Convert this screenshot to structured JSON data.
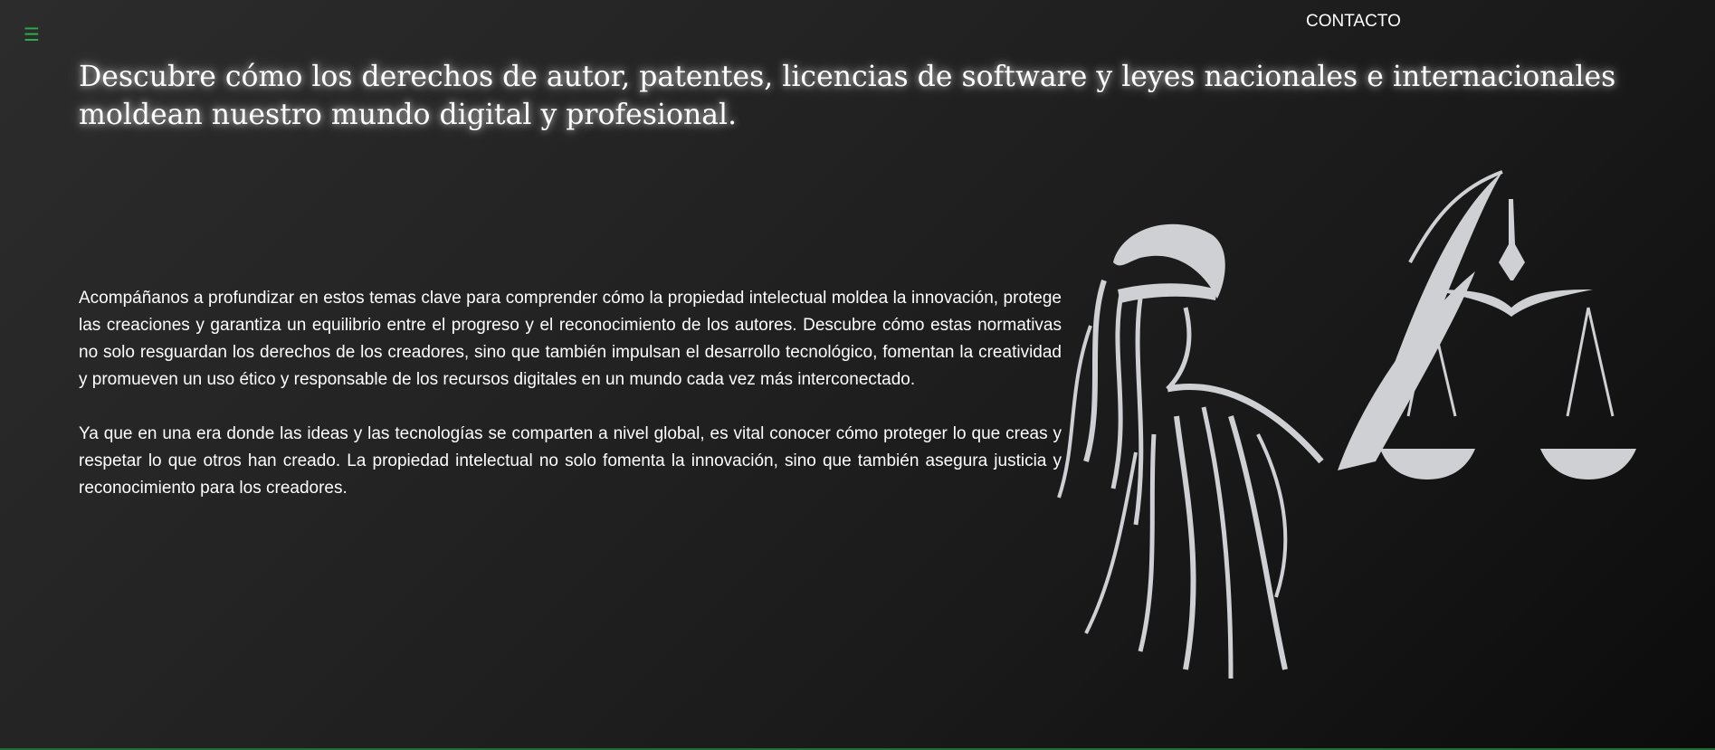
{
  "nav": {
    "menu_icon": "hamburger-menu-icon",
    "menu_glyph": "☰",
    "contact_label": "CONTACTO"
  },
  "hero": {
    "title": "Descubre cómo los derechos de autor, patentes, licencias de software y leyes nacionales e internacionales moldean nuestro mundo digital y profesional."
  },
  "content": {
    "paragraph_1": "Acompáñanos a profundizar en estos temas clave para comprender cómo la propiedad intelectual moldea la innovación, protege las creaciones y garantiza un equilibrio entre el progreso y el reconocimiento de los autores. Descubre cómo estas normativas no solo resguardan los derechos de los creadores, sino que también impulsan el desarrollo tecnológico, fomentan la creatividad y promueven un uso ético y responsable de los recursos digitales en un mundo cada vez más interconectado.",
    "paragraph_2": "Ya que en una era donde las ideas y las tecnologías se comparten a nivel global, es vital conocer cómo proteger lo que creas y respetar lo que otros han creado. La propiedad intelectual no solo fomenta la innovación, sino que también asegura justicia y reconocimiento para los creadores."
  },
  "illustration": {
    "icon": "lady-justice-illustration",
    "color": "#cfd0d3"
  },
  "colors": {
    "accent": "#2faa4b",
    "background_dark": "#0c0c0c",
    "background_light": "#2c2c2c"
  }
}
